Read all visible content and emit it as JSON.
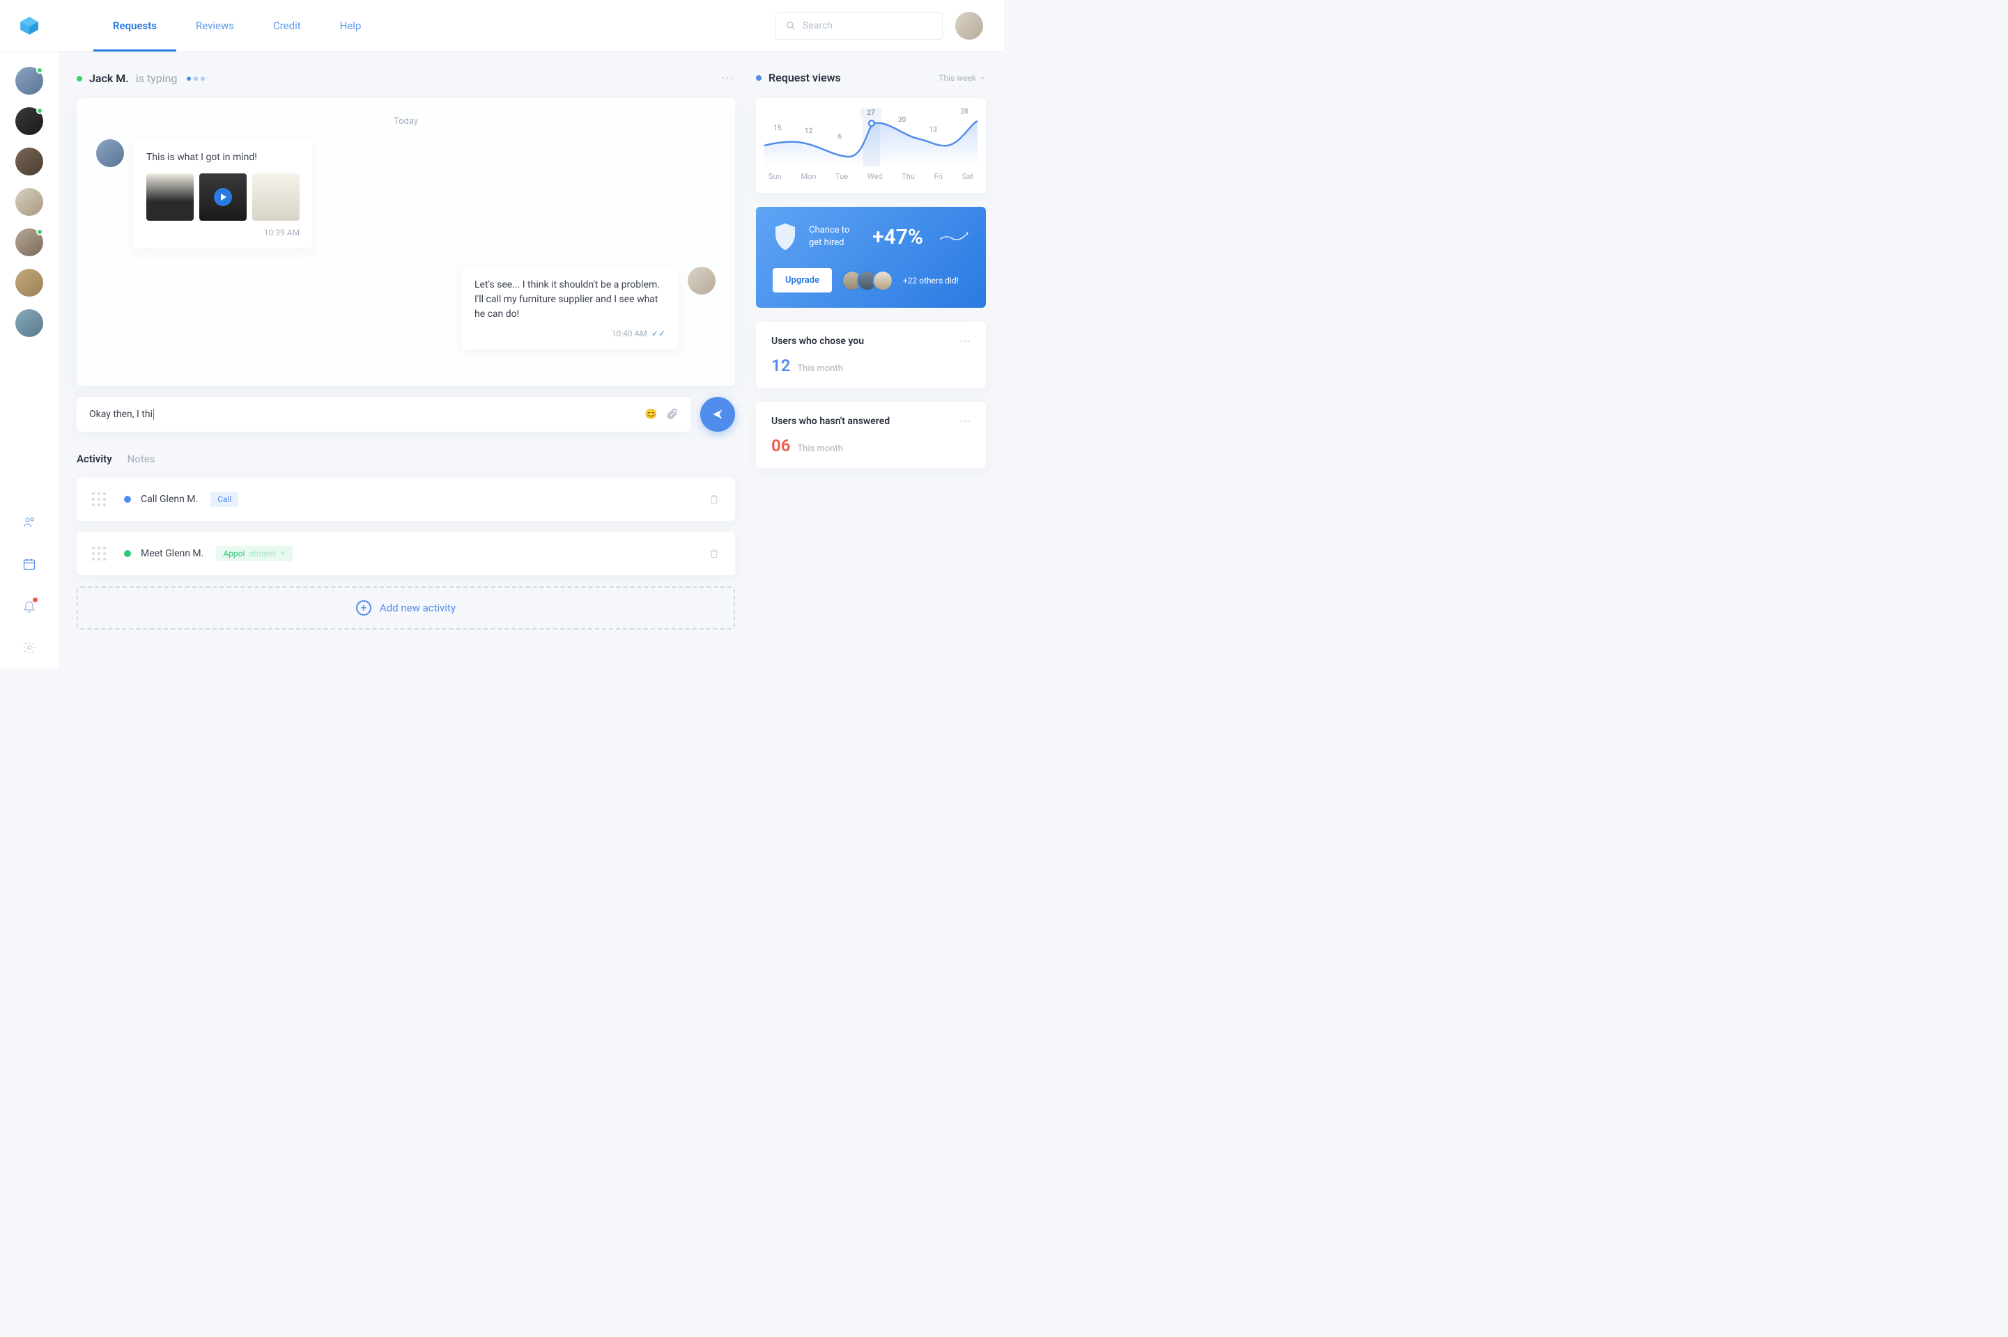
{
  "nav": {
    "tabs": [
      "Requests",
      "Reviews",
      "Credit",
      "Help"
    ],
    "search_placeholder": "Search"
  },
  "chat": {
    "name": "Jack M.",
    "typing": "is typing",
    "date": "Today",
    "msg1": {
      "text": "This is what I got in mind!",
      "time": "10:39 AM"
    },
    "msg2": {
      "text": "Let's see... I think it shouldn't be a problem. I'll call my furniture supplier and I see what he can do!",
      "time": "10:40 AM"
    },
    "compose": "Okay then, I thi"
  },
  "activity": {
    "tab1": "Activity",
    "tab2": "Notes",
    "rows": [
      {
        "title": "Call Glenn M.",
        "tag": "Call",
        "color": "#4f8cec"
      },
      {
        "title": "Meet Glenn M.",
        "tag_pre": "Appoi",
        "tag_suf": "ntment",
        "color": "#30c97a"
      }
    ],
    "add": "Add new activity"
  },
  "rv": {
    "title": "Request views",
    "period": "This week"
  },
  "chart_data": {
    "type": "line",
    "categories": [
      "Sun",
      "Mon",
      "Tue",
      "Wed",
      "Thu",
      "Fri",
      "Sat"
    ],
    "values": [
      15,
      12,
      6,
      27,
      20,
      13,
      28
    ],
    "title": "Request views",
    "ylim": [
      0,
      30
    ]
  },
  "promo": {
    "line1": "Chance to",
    "line2": "get hired",
    "pct": "+47%",
    "btn": "Upgrade",
    "others": "+22 others did!"
  },
  "stats": {
    "chose": {
      "title": "Users who chose you",
      "num": "12",
      "per": "This month"
    },
    "unanswered": {
      "title": "Users who hasn't answered",
      "num": "06",
      "per": "This month"
    }
  }
}
